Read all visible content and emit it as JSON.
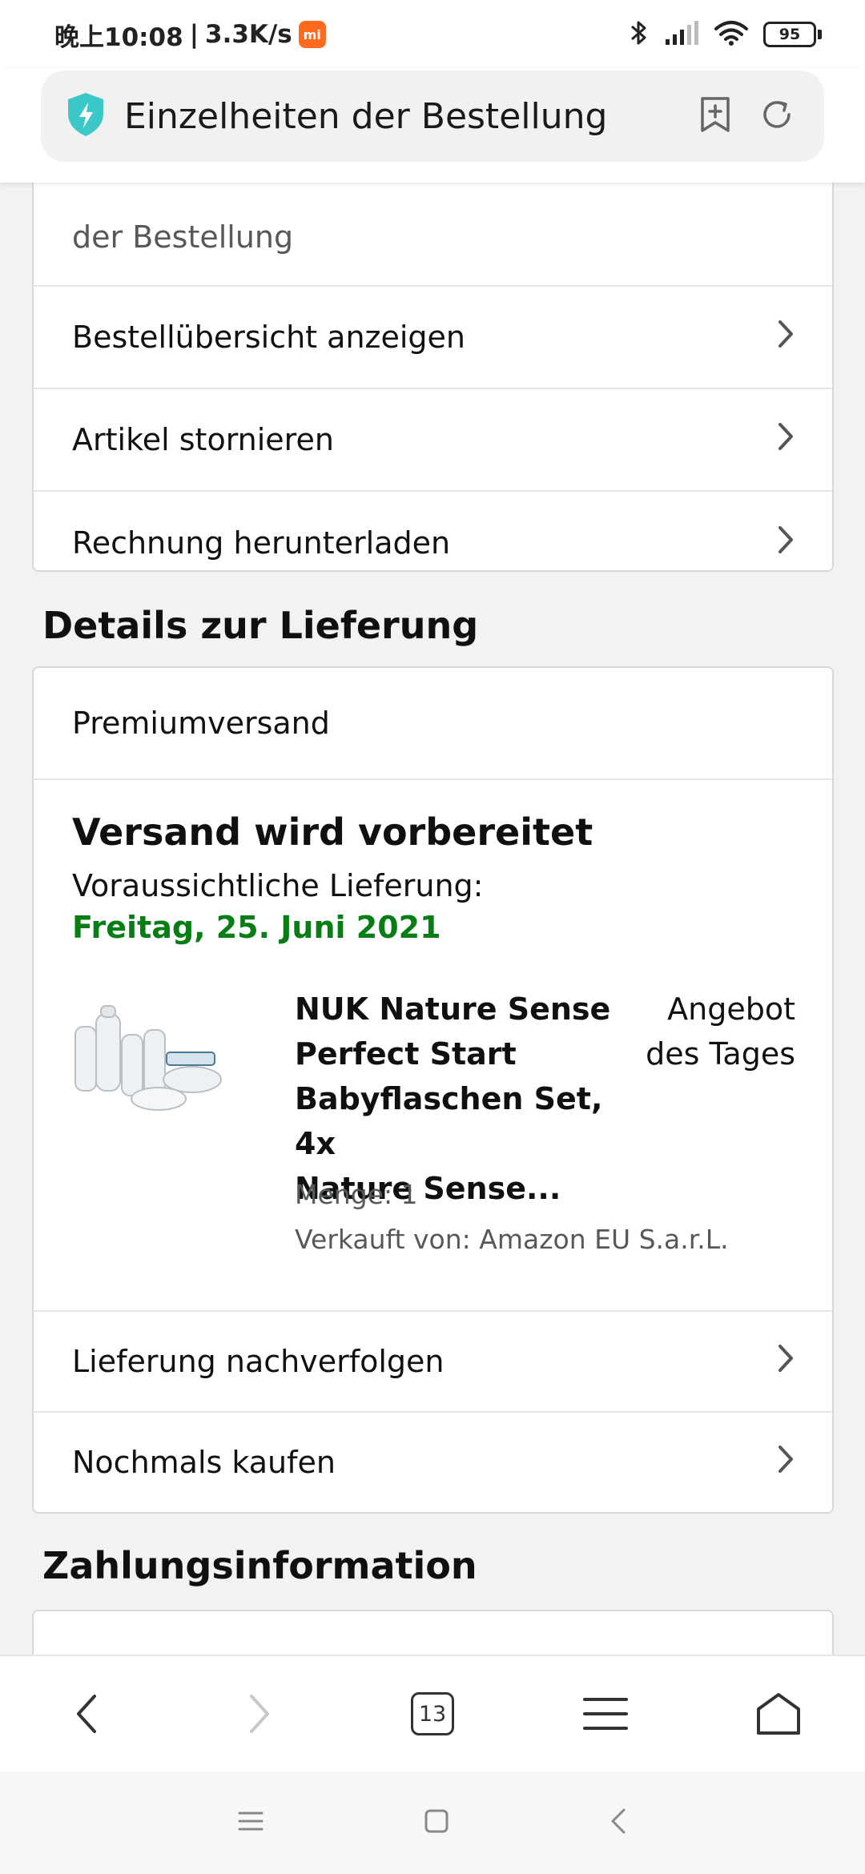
{
  "status_bar": {
    "time": "晚上10:08",
    "separator": "|",
    "net_speed": "3.3K/s",
    "mi_badge": "mi",
    "battery": "95",
    "icons": [
      "bluetooth-icon",
      "signal-icon",
      "wifi-icon",
      "battery-icon"
    ]
  },
  "browser": {
    "page_title": "Einzelheiten der Bestellung",
    "icons": [
      "shield-icon",
      "bookmark-add-icon",
      "reload-icon"
    ],
    "toolbar": {
      "tab_count": "13",
      "icons": [
        "back-icon",
        "forward-icon",
        "tabs-icon",
        "menu-icon",
        "home-icon"
      ]
    }
  },
  "order_actions": {
    "partial_text": "der Bestellung",
    "items": [
      {
        "label": "Bestellübersicht anzeigen"
      },
      {
        "label": "Artikel stornieren"
      },
      {
        "label": "Rechnung herunterladen"
      }
    ]
  },
  "delivery": {
    "section_title": "Details zur Lieferung",
    "shipping_method": "Premiumversand",
    "status": "Versand wird vorbereitet",
    "estimated_label": "Voraussichtliche Lieferung:",
    "estimated_date": "Freitag, 25. Juni 2021",
    "product": {
      "name_lines": [
        "NUK Nature Sense",
        "Perfect Start",
        "Babyflaschen Set, 4x",
        "Nature Sense..."
      ],
      "deal_lines": [
        "Angebot",
        "des Tages"
      ],
      "quantity": "Menge: 1",
      "sold_by": "Verkauft von: Amazon EU S.a.r.L."
    },
    "actions": [
      {
        "label": "Lieferung nachverfolgen"
      },
      {
        "label": "Nochmals kaufen"
      }
    ]
  },
  "payment": {
    "section_title": "Zahlungsinformation"
  },
  "colors": {
    "delivery_date": "#067d15",
    "shield": "#3cc8c8",
    "mi_badge": "#ff6a1f",
    "card_border": "#d5d9d9"
  }
}
